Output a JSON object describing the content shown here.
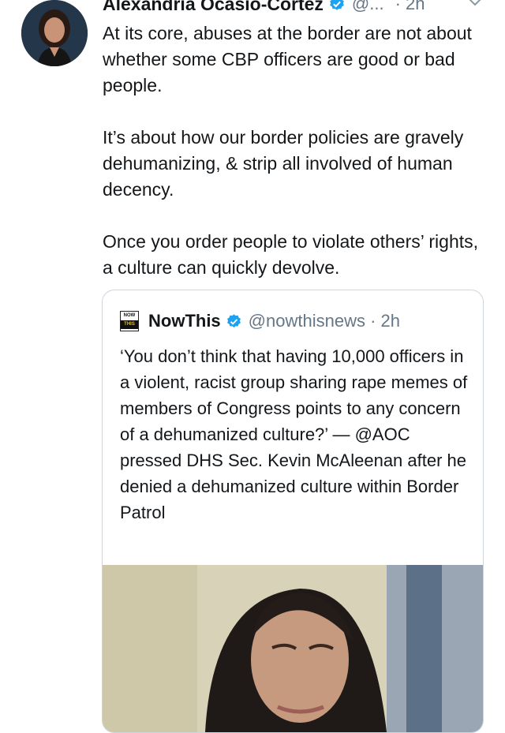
{
  "author": {
    "name": "Alexandria Ocasio-Cortez",
    "handle": "@...",
    "time": "· 2h"
  },
  "tweet": {
    "paragraphs": [
      "At its core, abuses at the border are not about whether some CBP officers are good or bad people.",
      "It’s about how our border policies are gravely dehumanizing, & strip all involved of human decency.",
      "Once you order people to violate others’ rights, a culture can quickly devolve."
    ]
  },
  "quoted": {
    "logo_top": "NOW",
    "logo_bottom": "THIS",
    "name": "NowThis",
    "handle": "@nowthisnews · 2h",
    "text": "‘You don’t think that having 10,000 officers in a violent, racist group sharing rape memes of members of Congress points to any concern of a dehumanized culture?’ — @AOC pressed DHS Sec. Kevin McAleenan after he denied a dehumanized culture within Border Patrol"
  },
  "colors": {
    "verified": "#1da1f2",
    "muted": "#657786",
    "border": "#ccd6dd"
  },
  "icons": {
    "verified": "verified-badge-icon",
    "chevron": "chevron-down-icon"
  }
}
